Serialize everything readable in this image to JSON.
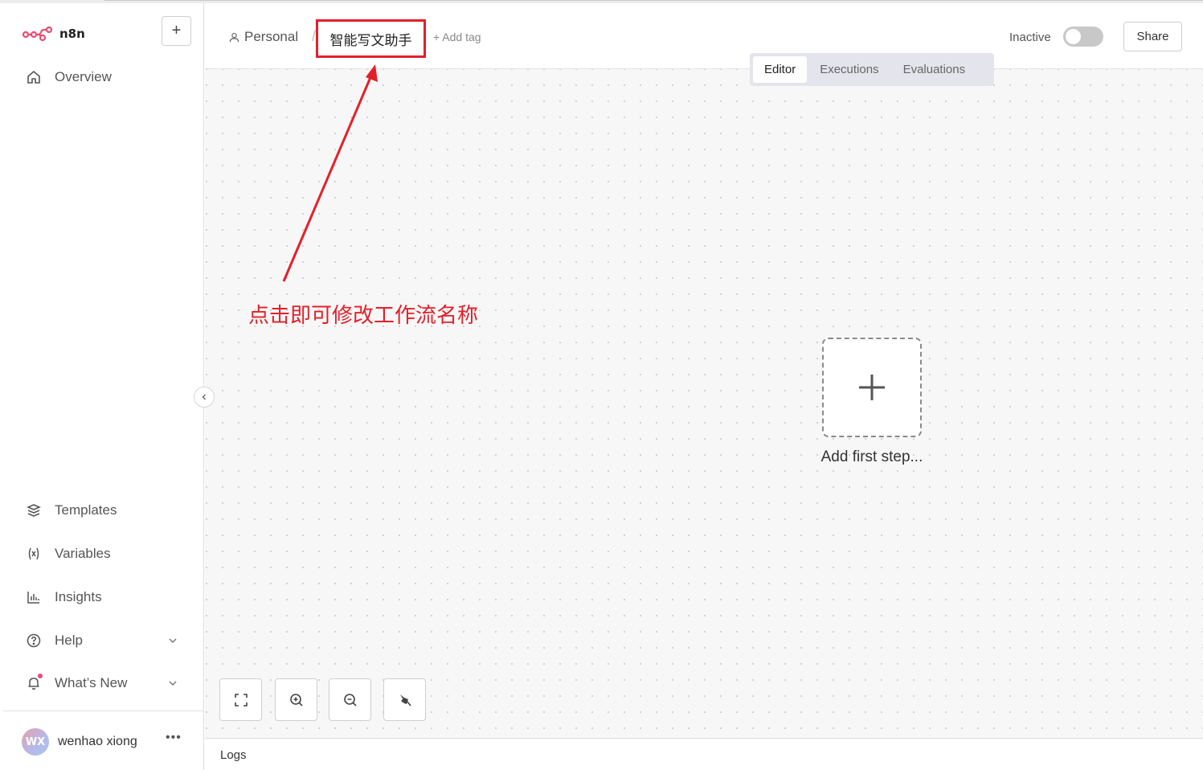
{
  "app": {
    "name": "n8n"
  },
  "sidebar": {
    "add_button_label": "+",
    "overview": "Overview",
    "items": [
      {
        "label": "Templates",
        "icon": "templates-icon"
      },
      {
        "label": "Variables",
        "icon": "variables-icon"
      },
      {
        "label": "Insights",
        "icon": "insights-icon"
      },
      {
        "label": "Help",
        "icon": "help-icon"
      },
      {
        "label": "What’s New",
        "icon": "bell-icon"
      }
    ],
    "user": {
      "initials": "WX",
      "name": "wenhao xiong"
    }
  },
  "header": {
    "breadcrumb_project": "Personal",
    "separator": "/",
    "workflow_name": "智能写文助手",
    "add_tag": "+ Add tag",
    "status_label": "Inactive",
    "active": false,
    "share": "Share"
  },
  "tabs": [
    {
      "label": "Editor",
      "active": true
    },
    {
      "label": "Executions",
      "active": false
    },
    {
      "label": "Evaluations",
      "active": false
    }
  ],
  "canvas": {
    "add_first_step": "Add first step...",
    "annotation": "点击即可修改工作流名称",
    "annotation_color": "#e3202a"
  },
  "logs": {
    "label": "Logs"
  },
  "colors": {
    "accent": "#ea4b71",
    "annotation": "#e3202a"
  }
}
